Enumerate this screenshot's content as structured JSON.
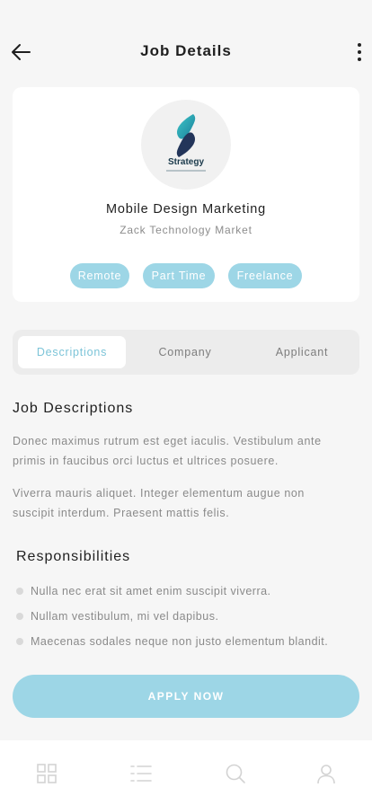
{
  "header": {
    "title": "Job Details",
    "back_icon": "arrow-left-icon",
    "menu_icon": "more-vertical-icon"
  },
  "job": {
    "logo_text": "Strategy",
    "title": "Mobile Design Marketing",
    "company": "Zack Technology Market",
    "tags": [
      "Remote",
      "Part Time",
      "Freelance"
    ]
  },
  "tabs": [
    {
      "label": "Descriptions",
      "active": true
    },
    {
      "label": "Company",
      "active": false
    },
    {
      "label": "Applicant",
      "active": false
    }
  ],
  "description": {
    "title": "Job Descriptions",
    "paragraphs": [
      "Donec maximus rutrum est eget iaculis. Vestibulum ante primis in faucibus orci luctus et ultrices posuere.",
      "Viverra mauris  aliquet. Integer elementum augue non suscipit interdum. Praesent mattis felis."
    ]
  },
  "responsibilities": {
    "title": "Responsibilities",
    "items": [
      "Nulla nec erat sit amet enim suscipit viverra.",
      "Nullam vestibulum, mi vel dapibus.",
      "Maecenas sodales neque non justo elementum blandit."
    ]
  },
  "apply_button": "APPLY NOW",
  "bottom_nav": [
    "grid-icon",
    "list-icon",
    "search-icon",
    "user-icon"
  ],
  "colors": {
    "accent": "#9dd6e6",
    "accent_text": "#7cc4d8",
    "background": "#f6f6f6",
    "muted_text": "#8a8a8a"
  }
}
